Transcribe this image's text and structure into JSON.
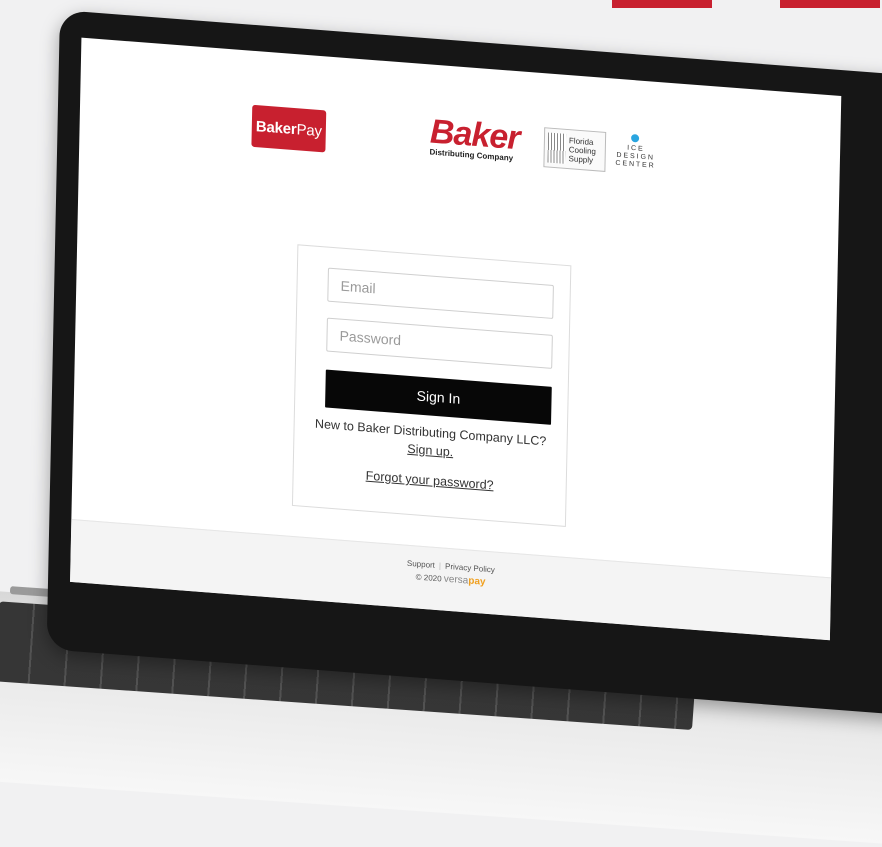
{
  "brand": {
    "bakerpay_logo": {
      "bold": "Baker",
      "regular": "Pay"
    },
    "baker_logo": {
      "word": "Baker",
      "sub": "Distributing Company"
    },
    "fcs_logo": [
      "Florida",
      "Cooling",
      "Supply"
    ],
    "ice_logo": [
      "I C E",
      "D E S I G N",
      "C E N T E R"
    ]
  },
  "login": {
    "email_placeholder": "Email",
    "password_placeholder": "Password",
    "signin_label": "Sign In",
    "new_to_text": "New to Baker Distributing Company LLC?",
    "signup_label": "Sign up.",
    "forgot_label": "Forgot your password?"
  },
  "footer": {
    "support_label": "Support",
    "privacy_label": "Privacy Policy",
    "copyright": "© 2020",
    "versa": "versa",
    "pay": "pay"
  },
  "colors": {
    "brand_red": "#c8202f",
    "button_black": "#070707",
    "versapay_orange": "#f0a020"
  }
}
